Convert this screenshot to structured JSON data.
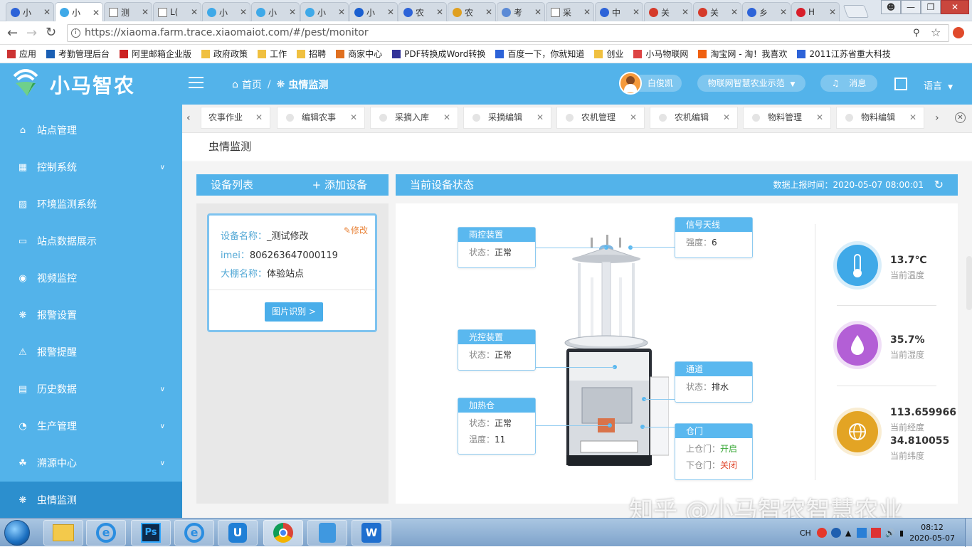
{
  "browser": {
    "tabs": [
      {
        "title": "小",
        "icon": "baidu-paw-icon",
        "active": false
      },
      {
        "title": "小",
        "icon": "app-logo-icon",
        "active": true
      },
      {
        "title": "测",
        "icon": "page-icon",
        "active": false
      },
      {
        "title": "L(",
        "icon": "page-icon",
        "active": false
      },
      {
        "title": "小",
        "icon": "app-logo-icon",
        "active": false
      },
      {
        "title": "小",
        "icon": "app-logo-icon",
        "active": false
      },
      {
        "title": "小",
        "icon": "app-logo-icon",
        "active": false
      },
      {
        "title": "小",
        "icon": "triangle-icon",
        "active": false
      },
      {
        "title": "农",
        "icon": "baidu-paw-icon",
        "active": false
      },
      {
        "title": "农",
        "icon": "s-icon",
        "active": false
      },
      {
        "title": "考",
        "icon": "doc-icon",
        "active": false
      },
      {
        "title": "采",
        "icon": "page-icon",
        "active": false
      },
      {
        "title": "中",
        "icon": "baidu-paw-icon",
        "active": false
      },
      {
        "title": "关",
        "icon": "emblem-icon",
        "active": false
      },
      {
        "title": "关",
        "icon": "emblem-icon",
        "active": false
      },
      {
        "title": "乡",
        "icon": "baidu-paw-icon",
        "active": false
      },
      {
        "title": "H",
        "icon": "huawei-icon",
        "active": false
      }
    ],
    "url": "https://xiaoma.farm.trace.xiaomaiot.com/#/pest/monitor",
    "bookmarks": [
      {
        "label": "应用",
        "color": "#cc3333"
      },
      {
        "label": "考勤管理后台",
        "color": "#1a5fb4"
      },
      {
        "label": "阿里邮箱企业版",
        "color": "#cc2222"
      },
      {
        "label": "政府政策",
        "color": "#f0c040"
      },
      {
        "label": "工作",
        "color": "#f0c040"
      },
      {
        "label": "招聘",
        "color": "#f0c040"
      },
      {
        "label": "商家中心",
        "color": "#e07020"
      },
      {
        "label": "PDF转换成Word转换",
        "color": "#333399"
      },
      {
        "label": "百度一下，你就知道",
        "color": "#2d63d8"
      },
      {
        "label": "创业",
        "color": "#f0c040"
      },
      {
        "label": "小马物联网",
        "color": "#d44"
      },
      {
        "label": "淘宝网 - 淘！我喜欢",
        "color": "#f06010"
      },
      {
        "label": "2011江苏省重大科技",
        "color": "#2d63d8"
      }
    ]
  },
  "app": {
    "name": "小马智农",
    "breadcrumb": {
      "home": "首页",
      "current": "虫情监测"
    },
    "user": "白俊凯",
    "project": "物联网智慧农业示范",
    "messages": "消息",
    "language": "语言"
  },
  "sidebar": {
    "items": [
      {
        "label": "站点管理",
        "icon": "home-icon",
        "expandable": false,
        "active": false
      },
      {
        "label": "控制系统",
        "icon": "grid-icon",
        "expandable": true,
        "active": false
      },
      {
        "label": "环境监测系统",
        "icon": "image-icon",
        "expandable": false,
        "active": false
      },
      {
        "label": "站点数据展示",
        "icon": "monitor-icon",
        "expandable": false,
        "active": false
      },
      {
        "label": "视频监控",
        "icon": "camera-icon",
        "expandable": false,
        "active": false
      },
      {
        "label": "报警设置",
        "icon": "bug-icon",
        "expandable": false,
        "active": false
      },
      {
        "label": "报警提醒",
        "icon": "warning-icon",
        "expandable": false,
        "active": false
      },
      {
        "label": "历史数据",
        "icon": "calendar-icon",
        "expandable": true,
        "active": false
      },
      {
        "label": "生产管理",
        "icon": "gauge-icon",
        "expandable": true,
        "active": false
      },
      {
        "label": "溯源中心",
        "icon": "network-icon",
        "expandable": true,
        "active": false
      },
      {
        "label": "虫情监测",
        "icon": "bug-icon",
        "expandable": false,
        "active": true
      }
    ]
  },
  "nav_tabs": [
    {
      "label": "农事作业"
    },
    {
      "label": "编辑农事"
    },
    {
      "label": "采摘入库"
    },
    {
      "label": "采摘编辑"
    },
    {
      "label": "农机管理"
    },
    {
      "label": "农机编辑"
    },
    {
      "label": "物料管理"
    },
    {
      "label": "物料编辑"
    }
  ],
  "page_title": "虫情监测",
  "device_list": {
    "title": "设备列表",
    "add_button": "+ 添加设备",
    "device": {
      "name_label": "设备名称：",
      "name": "_测试修改",
      "imei_label": "imei：",
      "imei": "806263647000119",
      "shed_label": "大棚名称：",
      "shed": "体验站点",
      "edit": "修改",
      "recognize_button": "图片识别 >"
    }
  },
  "device_status": {
    "title": "当前设备状态",
    "report_time_label": "数据上报时间：",
    "report_time": "2020-05-07 08:00:01",
    "callouts": {
      "rain": {
        "title": "雨控装置",
        "state_label": "状态：",
        "state": "正常"
      },
      "signal": {
        "title": "信号天线",
        "strength_label": "强度：",
        "strength": "6"
      },
      "light": {
        "title": "光控装置",
        "state_label": "状态：",
        "state": "正常"
      },
      "channel": {
        "title": "通道",
        "state_label": "状态：",
        "state": "排水"
      },
      "heater": {
        "title": "加热仓",
        "state_label": "状态：",
        "state": "正常",
        "temp_label": "温度：",
        "temp": "11"
      },
      "door": {
        "title": "仓门",
        "upper_label": "上仓门：",
        "upper": "开启",
        "lower_label": "下仓门：",
        "lower": "关闭",
        "open_color": "#3aa838",
        "closed_color": "#e0462b"
      }
    },
    "metrics": {
      "temperature": {
        "value": "13.7℃",
        "label": "当前温度",
        "color": "#3fa9e8"
      },
      "humidity": {
        "value": "35.7%",
        "label": "当前湿度",
        "color": "#b35fd6"
      },
      "longitude": {
        "value": "113.659966",
        "label": "当前经度",
        "color": "#e3a424"
      },
      "latitude": {
        "value": "34.810055",
        "label": "当前纬度"
      }
    }
  },
  "watermark": "知乎 @小马智农智慧农业",
  "taskbar": {
    "lang": "CH",
    "time": "08:12",
    "date": "2020-05-07"
  },
  "colors": {
    "primary": "#53b3ea",
    "active_sidebar": "#2c8fce"
  }
}
